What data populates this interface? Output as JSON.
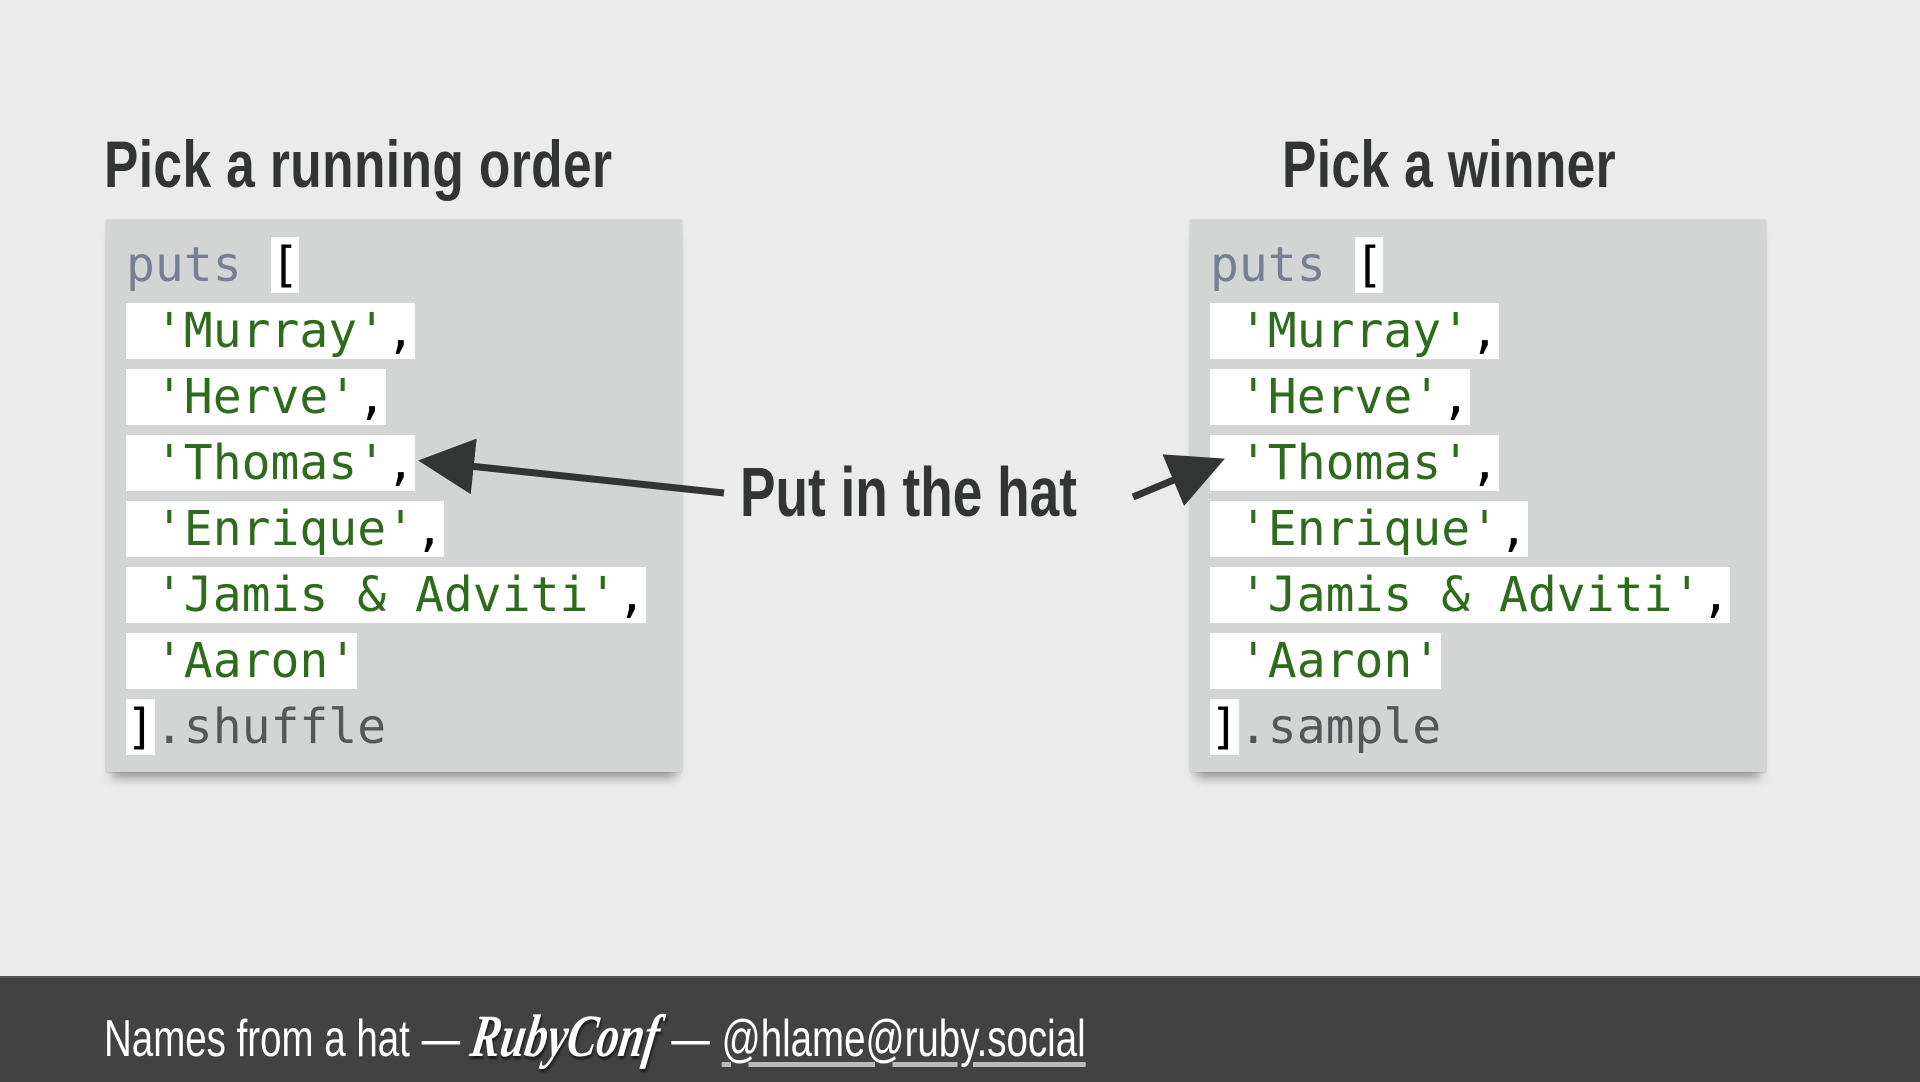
{
  "left_section": {
    "heading": "Pick a running order",
    "code": {
      "keyword": "puts",
      "open_bracket": "[",
      "items": [
        {
          "value": "'Murray'",
          "sep": ","
        },
        {
          "value": "'Herve'",
          "sep": ","
        },
        {
          "value": "'Thomas'",
          "sep": ","
        },
        {
          "value": "'Enrique'",
          "sep": ","
        },
        {
          "value": "'Jamis & Adviti'",
          "sep": ","
        },
        {
          "value": "'Aaron'",
          "sep": ""
        }
      ],
      "close_bracket": "]",
      "method": ".shuffle"
    }
  },
  "right_section": {
    "heading": "Pick a winner",
    "code": {
      "keyword": "puts",
      "open_bracket": "[",
      "items": [
        {
          "value": "'Murray'",
          "sep": ","
        },
        {
          "value": "'Herve'",
          "sep": ","
        },
        {
          "value": "'Thomas'",
          "sep": ","
        },
        {
          "value": "'Enrique'",
          "sep": ","
        },
        {
          "value": "'Jamis & Adviti'",
          "sep": ","
        },
        {
          "value": "'Aaron'",
          "sep": ""
        }
      ],
      "close_bracket": "]",
      "method": ".sample"
    }
  },
  "annotation": {
    "label": "Put in the hat",
    "arrow_icon": "arrow-icon"
  },
  "footer": {
    "title": "Names from a hat",
    "separator1": "—",
    "logo": "RubyConf",
    "separator2": "—",
    "handle": "@hlame@ruby.social"
  },
  "colors": {
    "background": "#ebebeb",
    "panel": "#d3d5d5",
    "heading": "#333535",
    "string": "#2e6b1c",
    "keyword": "#778092",
    "footer": "#424242"
  }
}
